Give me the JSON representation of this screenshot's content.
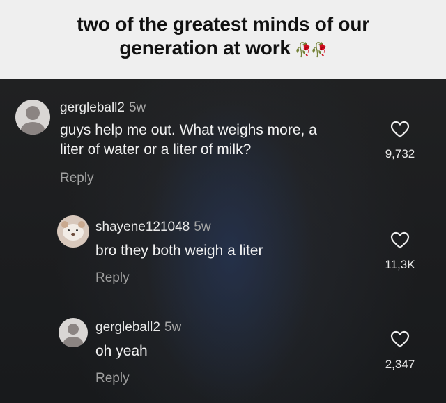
{
  "caption": {
    "text_line1": "two of the greatest minds of our",
    "text_line2": "generation at work",
    "emoji": "🥀🥀"
  },
  "comments": [
    {
      "username": "gergleball2",
      "age": "5w",
      "text_line1": "guys help me out. What weighs more, a",
      "text_line2": "liter of water or a liter of milk?",
      "reply_label": "Reply",
      "likes": "9,732",
      "avatar_icon": "default-avatar-icon"
    },
    {
      "username": "shayene121048",
      "age": "5w",
      "text": "bro they both weigh a liter",
      "reply_label": "Reply",
      "likes": "11,3K",
      "avatar_icon": "bear-avatar-icon"
    },
    {
      "username": "gergleball2",
      "age": "5w",
      "text": "oh yeah",
      "reply_label": "Reply",
      "likes": "2,347",
      "avatar_icon": "default-avatar-icon"
    }
  ],
  "colors": {
    "caption_bg": "#efefef",
    "panel_bg": "#1c1d1f",
    "username": "#e9e9e9",
    "secondary_text": "#a0a0a0"
  }
}
